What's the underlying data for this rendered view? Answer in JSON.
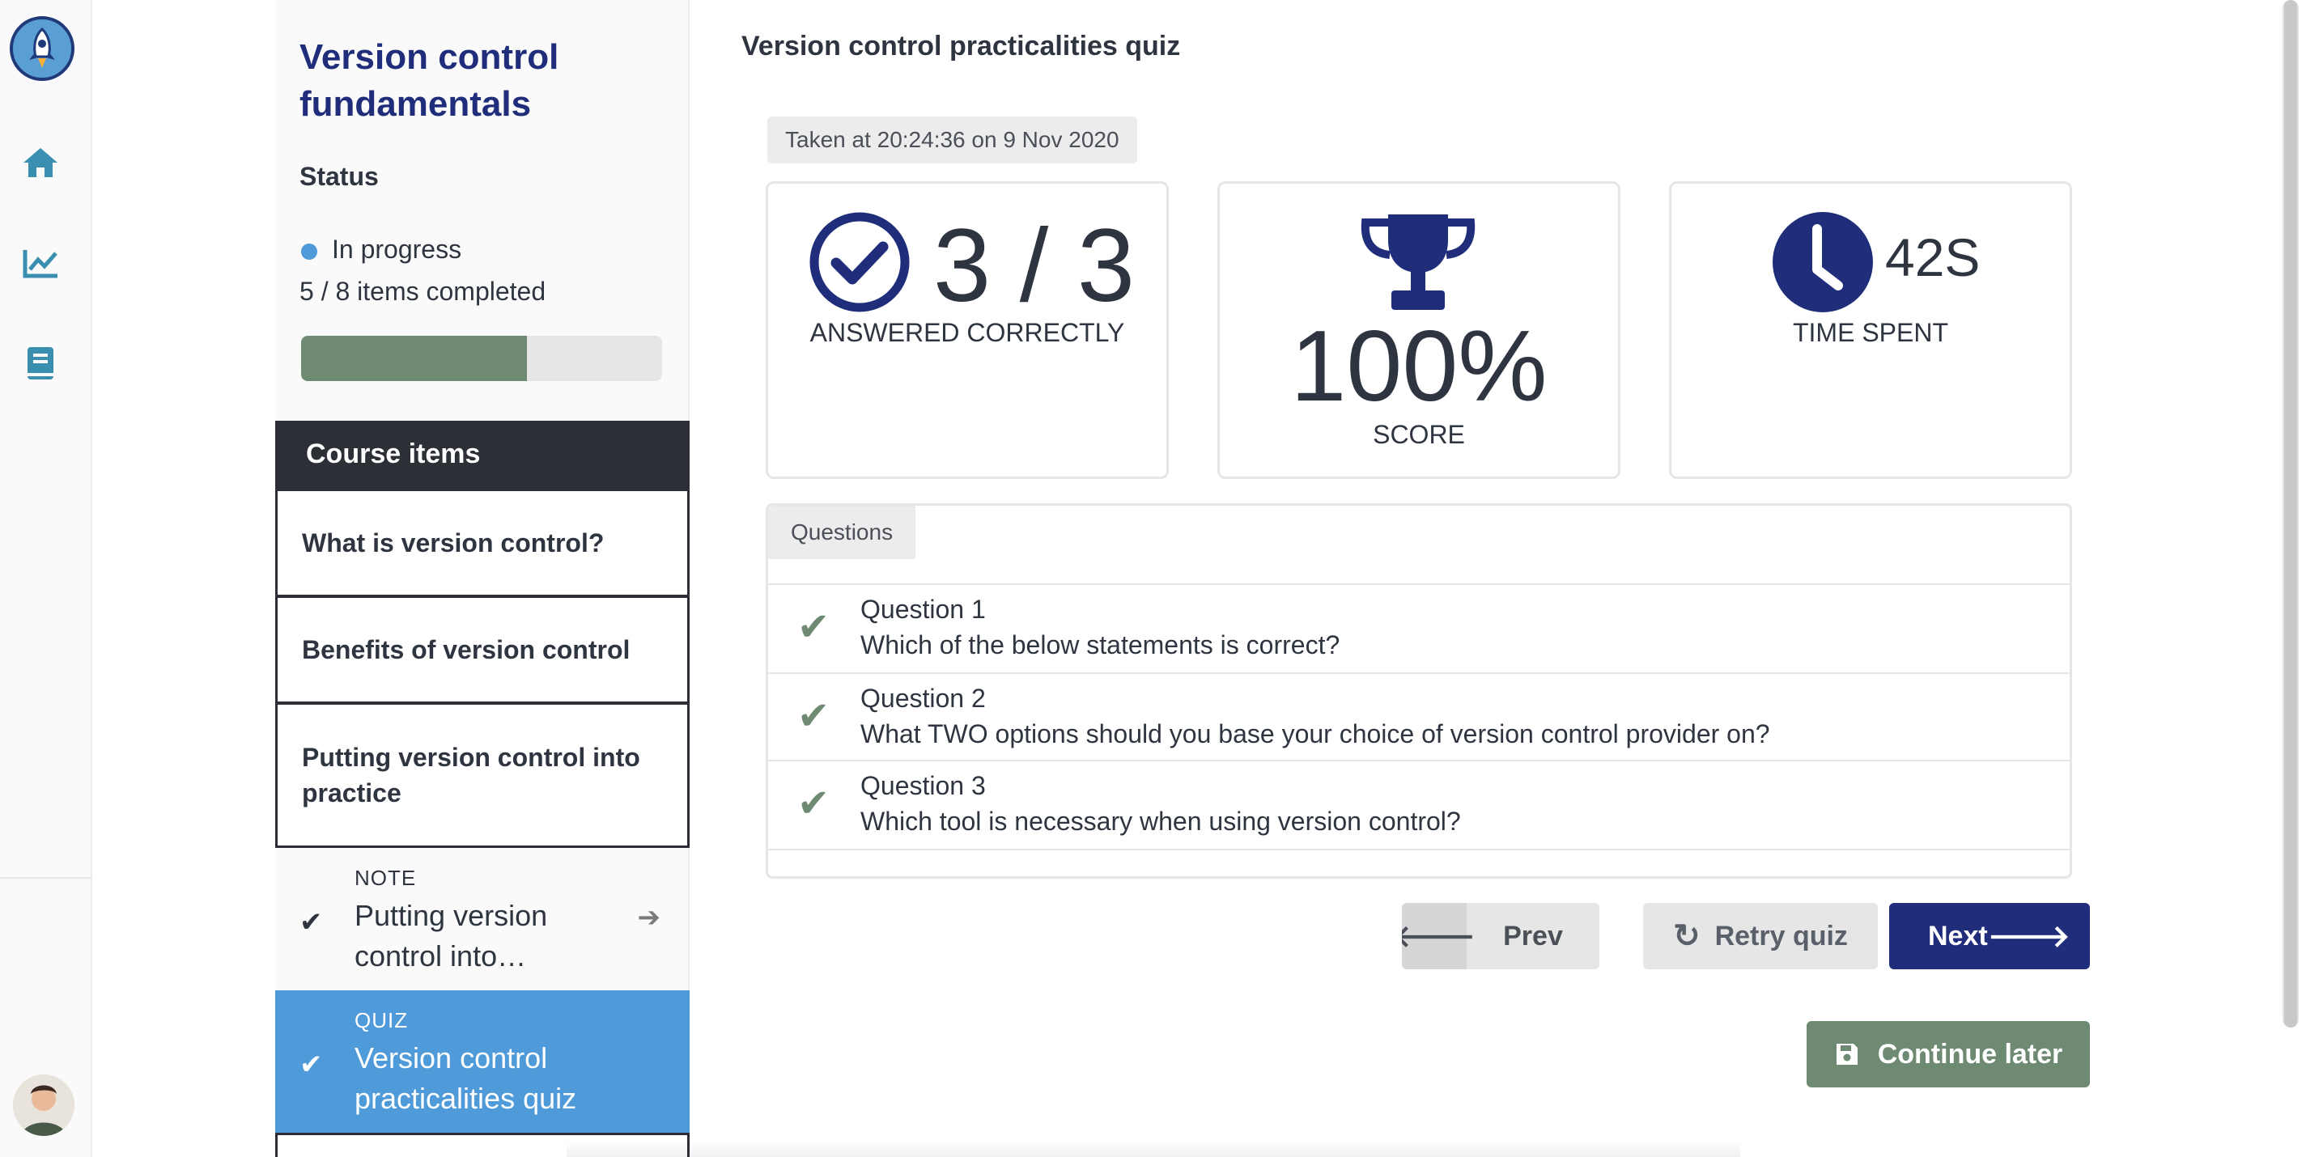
{
  "rail": {
    "logo_name": "rocket-logo",
    "nav": [
      {
        "name": "home-icon"
      },
      {
        "name": "chart-line-icon"
      },
      {
        "name": "book-icon"
      }
    ],
    "avatar_name": "user-avatar"
  },
  "sidebar": {
    "course_title": "Version control fundamentals",
    "status_label": "Status",
    "status_value": "In progress",
    "status_color": "#4f9bd9",
    "items_completed": "5 / 8 items completed",
    "progress_fraction": 0.625,
    "course_items_header": "Course items",
    "items": [
      {
        "label": "What is version control?"
      },
      {
        "label": "Benefits of version control"
      },
      {
        "label": "Putting version control into practice"
      }
    ],
    "sub_items": [
      {
        "type": "NOTE",
        "name": "Putting version control into…",
        "completed": true,
        "active": false
      },
      {
        "type": "QUIZ",
        "name": "Version control practicalities quiz",
        "completed": true,
        "active": true
      }
    ]
  },
  "main": {
    "title": "Version control practicalities quiz",
    "taken_at": "Taken at 20:24:36 on 9 Nov 2020",
    "cards": {
      "answered": {
        "value": "3 / 3",
        "label": "ANSWERED CORRECTLY",
        "icon": "check-circle-icon"
      },
      "score": {
        "value": "100%",
        "label": "SCORE",
        "icon": "trophy-icon"
      },
      "time": {
        "value": "42S",
        "label": "TIME SPENT",
        "icon": "clock-icon"
      }
    },
    "questions_tab": "Questions",
    "questions": [
      {
        "number": "Question 1",
        "text": "Which of the below statements is correct?",
        "correct": true
      },
      {
        "number": "Question 2",
        "text": "What TWO options should you base your choice of version control provider on?",
        "correct": true
      },
      {
        "number": "Question 3",
        "text": "Which tool is necessary when using version control?",
        "correct": true
      }
    ],
    "buttons": {
      "prev": "Prev",
      "retry": "Retry quiz",
      "next": "Next",
      "continue_later": "Continue later"
    }
  },
  "colors": {
    "brand_navy": "#1f2d7a",
    "accent_blue": "#4f9bd9",
    "success_green": "#6e8a72",
    "dark_header": "#2c2f36"
  }
}
